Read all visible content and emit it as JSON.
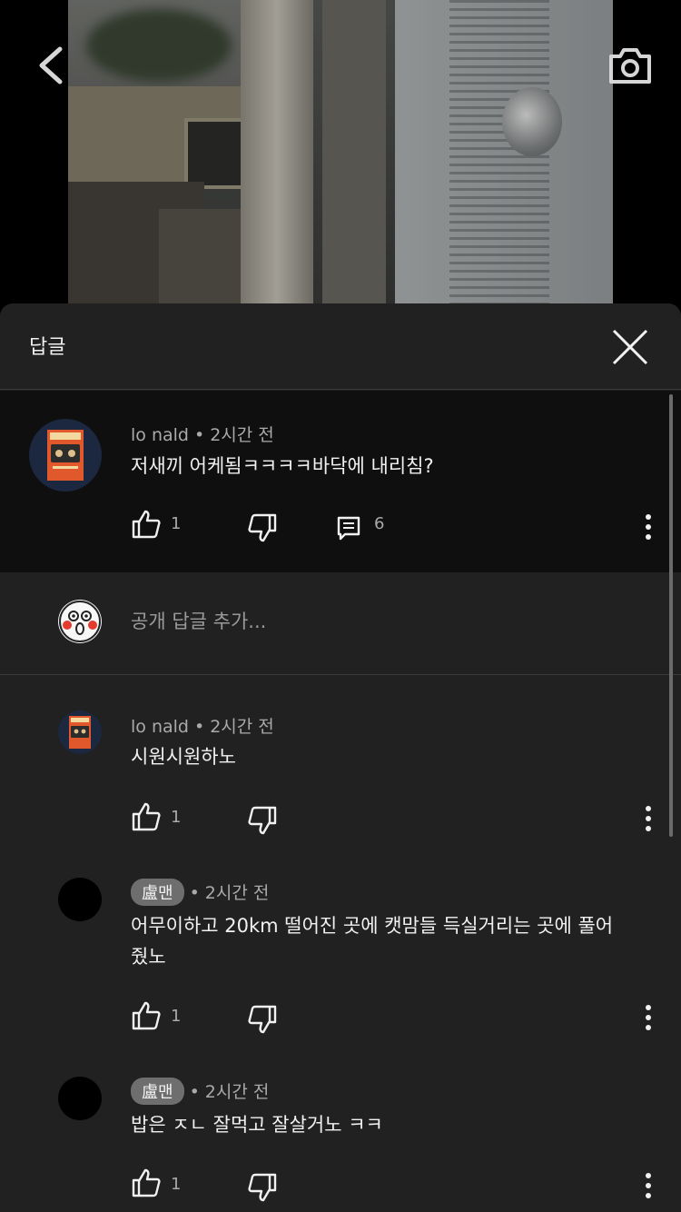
{
  "header": {
    "title": "답글",
    "back_icon": "chevron-left-icon",
    "camera_icon": "camera-icon",
    "close_icon": "close-icon"
  },
  "parent_comment": {
    "author": "lo nald",
    "time": "2시간 전",
    "text": "저새끼 어케됨ㅋㅋㅋㅋ바닥에 내리침?",
    "likes": "1",
    "replies": "6"
  },
  "add_reply": {
    "placeholder": "공개 답글 추가..."
  },
  "replies": [
    {
      "author": "lo nald",
      "time": "2시간 전",
      "text": "시원시원하노",
      "likes": "1"
    },
    {
      "author": "盧맨",
      "time": "2시간 전",
      "text_line1": "어무이하고 20km 떨어진 곳에 캣맘들 득실거리는 곳에 풀어",
      "text_line2": "줬노",
      "likes": "1"
    },
    {
      "author": "盧맨",
      "time": "2시간 전",
      "text": "밥은 ㅈㄴ 잘먹고 잘살거노 ㅋㅋ",
      "likes": "1"
    }
  ],
  "colors": {
    "sheet_bg": "#212121",
    "parent_bg": "#0f0f0f",
    "text": "#f1f1f1",
    "muted": "#aaaaaa"
  }
}
